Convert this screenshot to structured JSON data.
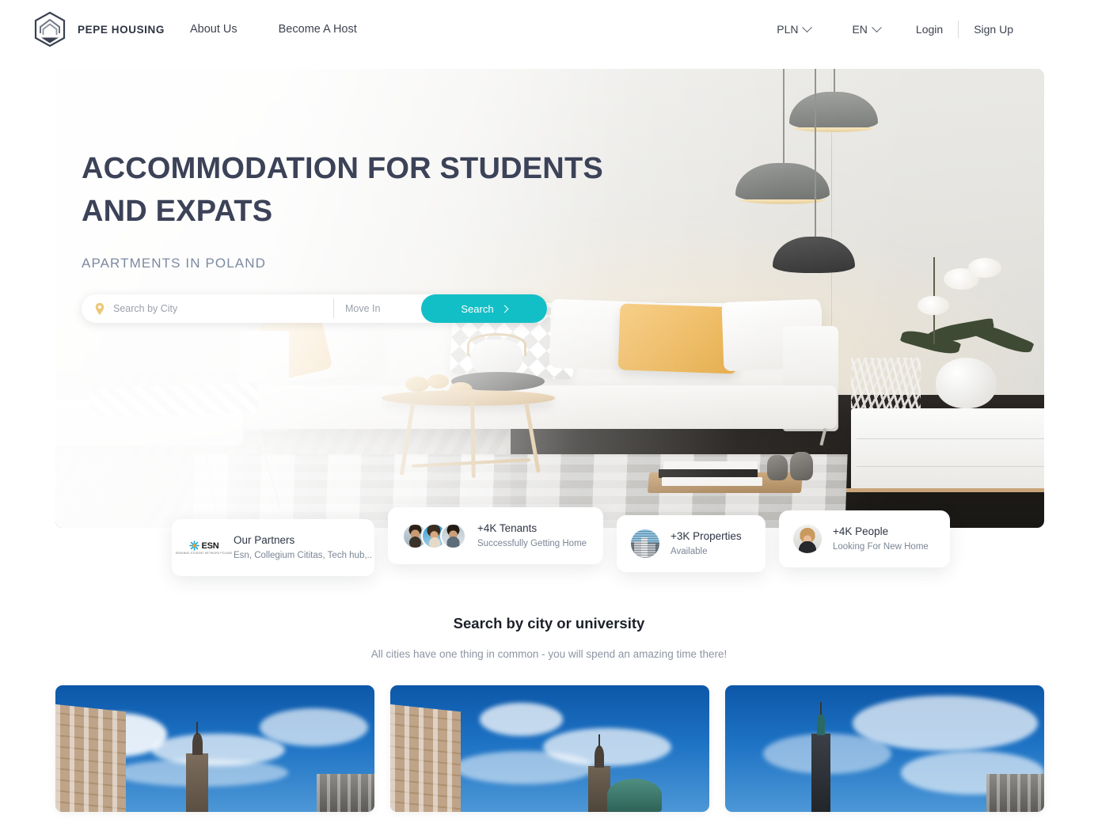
{
  "header": {
    "brand_name": "PEPE HOUSING",
    "logo_icon": "hexagon-house-logo-icon",
    "nav": [
      {
        "label": "About Us"
      },
      {
        "label": "Become A Host"
      }
    ],
    "currency_selector": {
      "label": "PLN",
      "icon": "chevron-down-icon"
    },
    "language_selector": {
      "label": "EN",
      "icon": "chevron-down-icon"
    },
    "login_label": "Login",
    "signup_label": "Sign Up"
  },
  "hero": {
    "title_line1": "ACCOMMODATION FOR STUDENTS",
    "title_line2": "AND EXPATS",
    "subtitle": "APARTMENTS IN POLAND",
    "image_alt": "living-room-interior-photo",
    "search": {
      "city_placeholder": "Search by City",
      "city_value": "",
      "city_icon": "location-pin-icon",
      "date_placeholder": "Move In",
      "date_value": "",
      "button_label": "Search",
      "button_icon": "chevron-right-icon",
      "button_color": "#13bfc6"
    }
  },
  "stat_cards": [
    {
      "icon": "esn-logo-icon",
      "esn_word": "ESN",
      "esn_tagline": "ERASMUS STUDENT NETWORK POLAND",
      "title": "Our Partners",
      "subtitle": "Esn, Collegium Cititas, Tech hub,.."
    },
    {
      "icon": "tenant-avatars-icon",
      "title": "+4K Tenants",
      "subtitle": "Successfully Getting Home"
    },
    {
      "icon": "property-building-thumbnail",
      "title": "+3K Properties",
      "subtitle": "Available"
    },
    {
      "icon": "person-portrait-thumbnail",
      "title": "+4K People",
      "subtitle": "Looking For New Home"
    }
  ],
  "city_section": {
    "heading": "Search by city or university",
    "description": "All cities have one thing in common - you will spend an amazing time there!",
    "cards": [
      {
        "image_alt": "city-photo-townhouses-blue-sky"
      },
      {
        "image_alt": "city-photo-tenement-green-dome"
      },
      {
        "image_alt": "city-photo-clock-tower-clouds"
      }
    ]
  },
  "colors": {
    "accent_teal": "#13bfc6",
    "heading_slate": "#3c4257",
    "muted_blue": "#7c8aa0",
    "pin_gold": "#e9bc5c"
  }
}
